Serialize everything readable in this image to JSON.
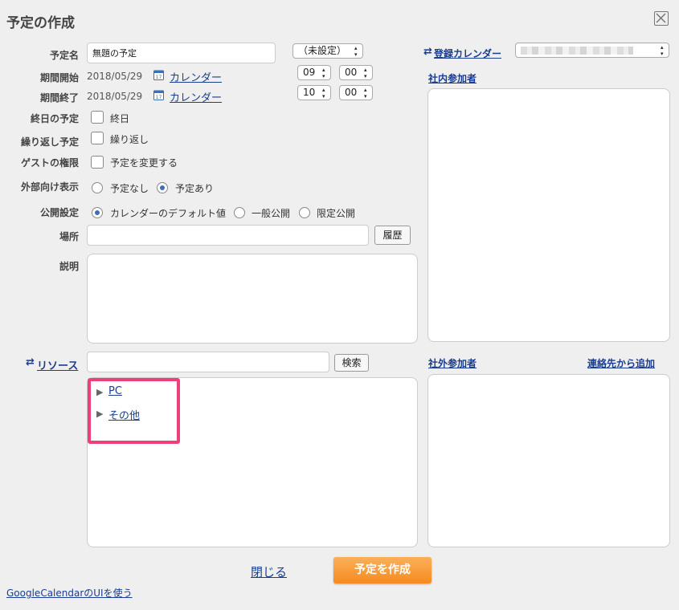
{
  "dialog": {
    "title": "予定の作成"
  },
  "fields": {
    "name_label": "予定名",
    "name_value": "無題の予定",
    "status_select": "（未設定）",
    "start_label": "期間開始",
    "start_date": "2018/05/29",
    "start_calendar_link": "カレンダー",
    "start_hour": "09",
    "start_min": "00",
    "end_label": "期間終了",
    "end_date": "2018/05/29",
    "end_calendar_link": "カレンダー",
    "end_hour": "10",
    "end_min": "00",
    "allday_label": "終日の予定",
    "allday_option": "終日",
    "repeat_label": "繰り返し予定",
    "repeat_option": "繰り返し",
    "guest_label": "ゲストの権限",
    "guest_option": "予定を変更する",
    "external_label": "外部向け表示",
    "external_options": [
      "予定なし",
      "予定あり"
    ],
    "public_label": "公開設定",
    "public_options": [
      "カレンダーのデフォルト値",
      "一般公開",
      "限定公開"
    ],
    "place_label": "場所",
    "place_value": "",
    "history_button": "履歴",
    "desc_label": "説明",
    "desc_value": ""
  },
  "right": {
    "calendar_link": "登録カレンダー",
    "internal_link": "社内参加者",
    "external_link": "社外参加者",
    "contacts_link": "連絡先から追加"
  },
  "resource": {
    "link": "リソース",
    "search_value": "",
    "search_button": "検索",
    "tree": [
      "PC",
      "その他"
    ]
  },
  "footer": {
    "close_link": "閉じる",
    "create_button": "予定を作成",
    "gc_link": "GoogleCalendarのUIを使う"
  },
  "colors": {
    "accent": "#f68a1f",
    "link": "#1a3d8f",
    "highlight": "#ee3f7a"
  }
}
